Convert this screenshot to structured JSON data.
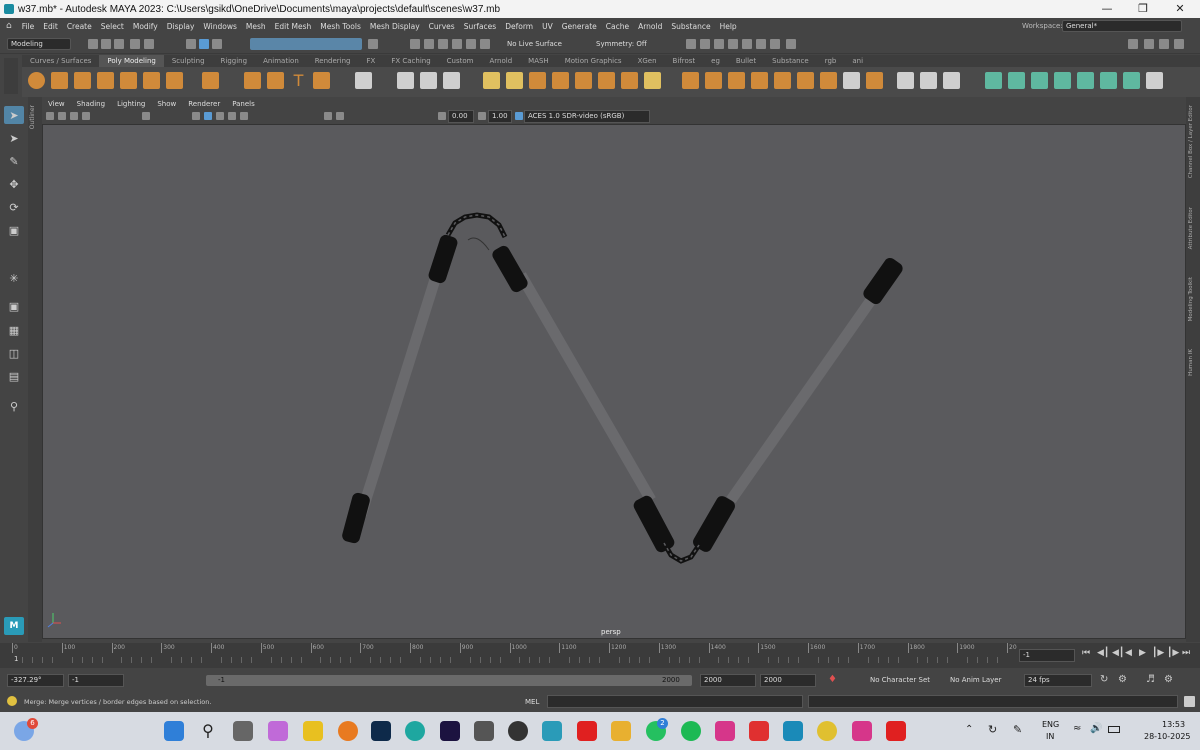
{
  "window": {
    "title": "w37.mb* - Autodesk MAYA 2023: C:\\Users\\gsikd\\OneDrive\\Documents\\maya\\projects\\default\\scenes\\w37.mb"
  },
  "menubar": {
    "items": [
      "File",
      "Edit",
      "Create",
      "Select",
      "Modify",
      "Display",
      "Windows",
      "Mesh",
      "Edit Mesh",
      "Mesh Tools",
      "Mesh Display",
      "Curves",
      "Surfaces",
      "Deform",
      "UV",
      "Generate",
      "Cache",
      "Arnold",
      "Substance",
      "Help"
    ],
    "workspace_label": "Workspace:",
    "workspace_value": "General*"
  },
  "statusline": {
    "mode": "Modeling",
    "live_surface": "No Live Surface",
    "symmetry": "Symmetry: Off"
  },
  "shelf": {
    "tabs": [
      "Curves / Surfaces",
      "Poly Modeling",
      "Sculpting",
      "Rigging",
      "Animation",
      "Rendering",
      "FX",
      "FX Caching",
      "Custom",
      "Arnold",
      "MASH",
      "Motion Graphics",
      "XGen",
      "Bifrost",
      "eg",
      "Bullet",
      "Substance",
      "rgb",
      "ani"
    ],
    "active_tab": "Poly Modeling"
  },
  "panel": {
    "menus": [
      "View",
      "Shading",
      "Lighting",
      "Show",
      "Renderer",
      "Panels"
    ],
    "exposure": "0.00",
    "gamma": "1.00",
    "colorspace": "ACES 1.0 SDR-video (sRGB)",
    "camera_label": "persp",
    "outliner_label": "Outliner"
  },
  "right_tabs": [
    "Channel Box / Layer Editor",
    "Attribute Editor",
    "Modeling Toolkit",
    "Human IK"
  ],
  "timeline": {
    "ticks": [
      "0",
      "100",
      "200",
      "300",
      "400",
      "500",
      "600",
      "700",
      "800",
      "900",
      "1000",
      "1100",
      "1200",
      "1300",
      "1400",
      "1500",
      "1600",
      "1700",
      "1800",
      "1900",
      "20"
    ],
    "start_marker": "1",
    "current_frame": "-1"
  },
  "range": {
    "field1": "-327.29°",
    "field2": "-1",
    "slider_start": "-1",
    "slider_end": "2000",
    "end1": "2000",
    "end2": "2000",
    "character_set": "No Character Set",
    "anim_layer": "No Anim Layer",
    "fps": "24 fps"
  },
  "cmd": {
    "help_text": "Merge: Merge vertices / border edges based on selection.",
    "mel_label": "MEL"
  },
  "taskbar": {
    "lang1": "ENG",
    "lang2": "IN",
    "time": "13:53",
    "date": "28-10-2025",
    "weather_badge": "6",
    "whatsapp_badge": "2"
  }
}
